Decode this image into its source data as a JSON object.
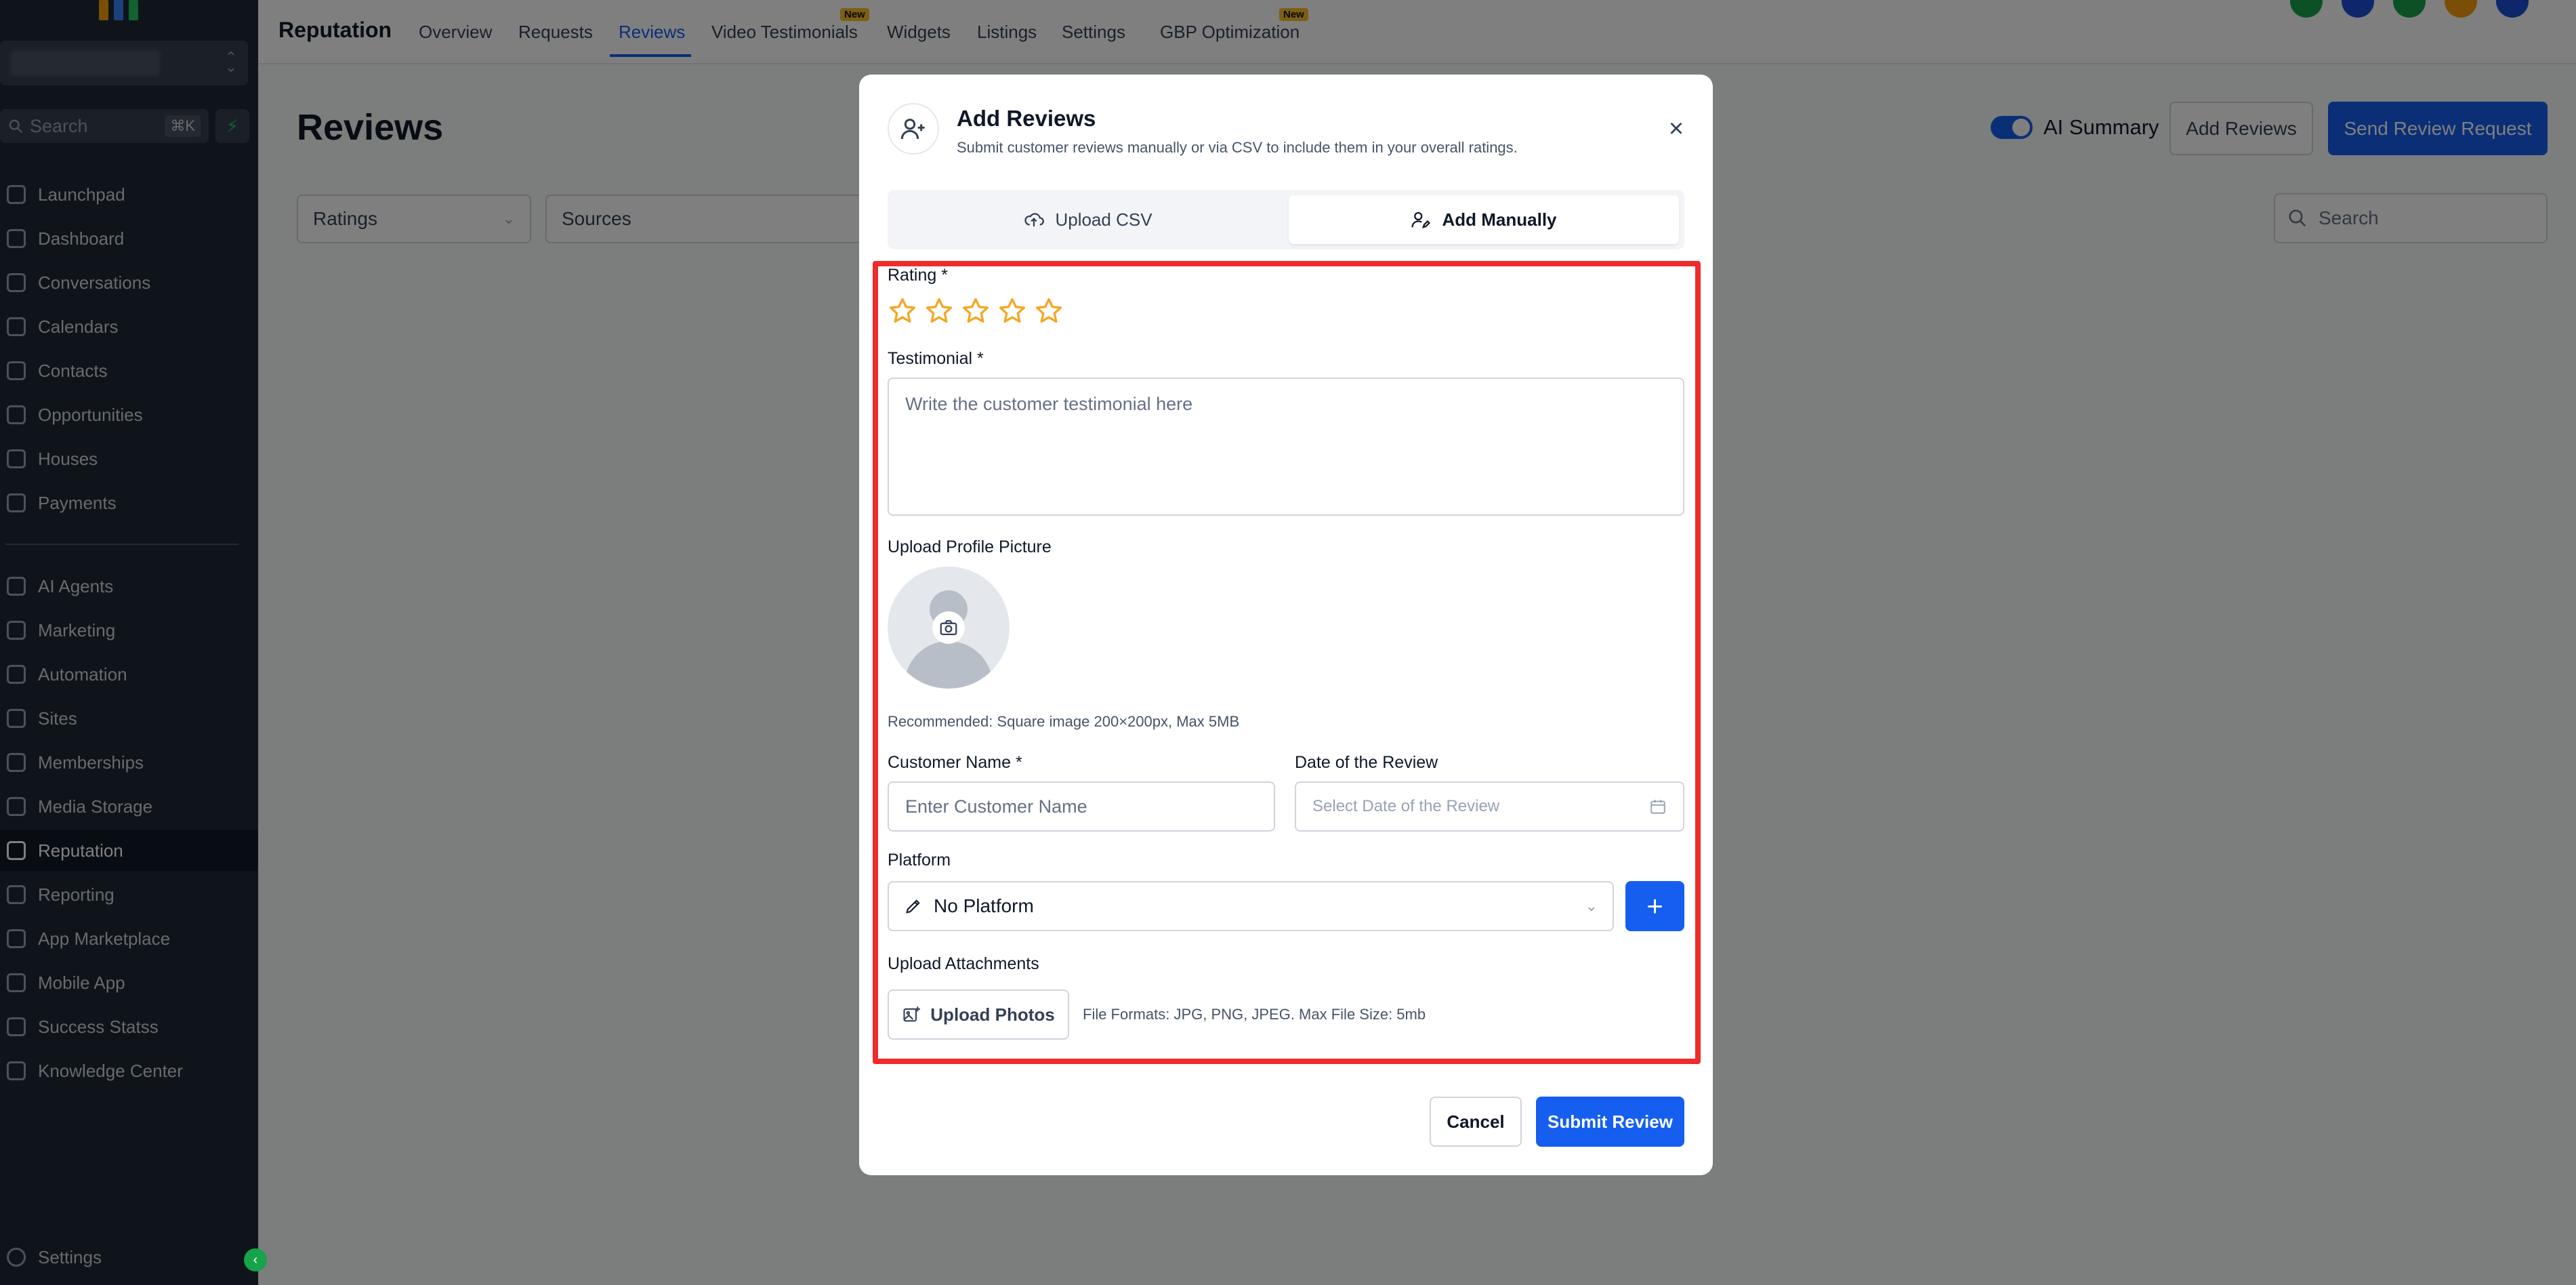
{
  "colors": {
    "sidebar_bg": "#1f2937",
    "accent": "#155eef",
    "highlight": "#ef2b2b",
    "star": "#f5a623",
    "new_badge": "#fbbf24"
  },
  "sidebar": {
    "search_placeholder": "Search",
    "search_shortcut": "⌘K",
    "bolt_icon": "⚡",
    "items_top": [
      {
        "label": "Launchpad",
        "icon": "rocket-icon"
      },
      {
        "label": "Dashboard",
        "icon": "grid-icon"
      },
      {
        "label": "Conversations",
        "icon": "chat-icon"
      },
      {
        "label": "Calendars",
        "icon": "calendar-icon"
      },
      {
        "label": "Contacts",
        "icon": "contacts-icon"
      },
      {
        "label": "Opportunities",
        "icon": "opportunities-icon"
      },
      {
        "label": "Houses",
        "icon": "house-icon"
      },
      {
        "label": "Payments",
        "icon": "payments-icon"
      }
    ],
    "items_bottom": [
      {
        "label": "AI Agents",
        "icon": "sparkle-icon"
      },
      {
        "label": "Marketing",
        "icon": "send-icon"
      },
      {
        "label": "Automation",
        "icon": "automation-icon"
      },
      {
        "label": "Sites",
        "icon": "sites-icon"
      },
      {
        "label": "Memberships",
        "icon": "memberships-icon"
      },
      {
        "label": "Media Storage",
        "icon": "image-icon"
      },
      {
        "label": "Reputation",
        "icon": "star-icon",
        "active": true
      },
      {
        "label": "Reporting",
        "icon": "trend-icon"
      },
      {
        "label": "App Marketplace",
        "icon": "apps-icon"
      },
      {
        "label": "Mobile App",
        "icon": "phone-icon"
      },
      {
        "label": "Success Statss",
        "icon": "chart-icon"
      },
      {
        "label": "Knowledge Center",
        "icon": "info-icon"
      }
    ],
    "settings_label": "Settings",
    "collapse_icon": "‹"
  },
  "topbar": {
    "title": "Reputation",
    "tabs": [
      {
        "label": "Overview"
      },
      {
        "label": "Requests"
      },
      {
        "label": "Reviews",
        "active": true
      },
      {
        "label": "Video Testimonials",
        "badge": "New"
      },
      {
        "label": "Widgets"
      },
      {
        "label": "Listings"
      },
      {
        "label": "Settings"
      },
      {
        "label": "GBP Optimization",
        "badge": "New"
      }
    ]
  },
  "page": {
    "title": "Reviews",
    "filters": {
      "ratings": "Ratings",
      "sources": "Sources"
    },
    "ai_summary_label": "AI Summary",
    "ai_summary_on": true,
    "add_reviews_label": "Add Reviews",
    "send_request_label": "Send Review Request",
    "search_placeholder": "Search"
  },
  "modal": {
    "title": "Add Reviews",
    "subtitle": "Submit customer reviews manually or via CSV to include them in your overall ratings.",
    "close_icon": "×",
    "tabs": {
      "upload_csv": "Upload CSV",
      "add_manually": "Add Manually",
      "active": "add_manually"
    },
    "rating_label": "Rating *",
    "rating_value": 0,
    "rating_max": 5,
    "testimonial_label": "Testimonial *",
    "testimonial_placeholder": "Write the customer testimonial here",
    "upload_picture_label": "Upload Profile Picture",
    "picture_hint": "Recommended: Square image 200×200px, Max 5MB",
    "customer_name_label": "Customer Name *",
    "customer_name_placeholder": "Enter Customer Name",
    "date_label": "Date of the Review",
    "date_placeholder": "Select Date of the Review",
    "platform_label": "Platform",
    "platform_value": "No Platform",
    "plus_icon": "+",
    "attachments_label": "Upload Attachments",
    "upload_photos_label": "Upload Photos",
    "formats_hint": "File Formats: JPG, PNG, JPEG. Max File Size: 5mb",
    "cancel_label": "Cancel",
    "submit_label": "Submit Review"
  }
}
